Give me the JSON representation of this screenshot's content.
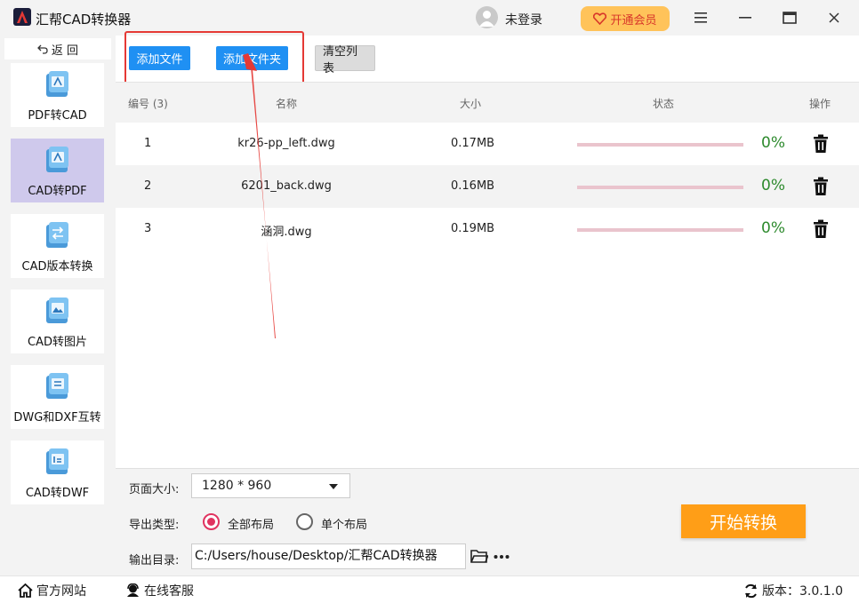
{
  "app": {
    "title": "汇帮CAD转换器",
    "user": "未登录",
    "vip": "开通会员"
  },
  "sidebar": {
    "back": "返 回",
    "items": [
      {
        "label": "PDF转CAD"
      },
      {
        "label": "CAD转PDF",
        "active": true
      },
      {
        "label": "CAD版本转换"
      },
      {
        "label": "CAD转图片"
      },
      {
        "label": "DWG和DXF互转"
      },
      {
        "label": "CAD转DWF"
      }
    ]
  },
  "toolbar": {
    "add_file": "添加文件",
    "add_folder": "添加文件夹",
    "clear_list": "清空列表"
  },
  "table": {
    "headers": {
      "index": "编号 (3)",
      "name": "名称",
      "size": "大小",
      "status": "状态",
      "action": "操作"
    },
    "rows": [
      {
        "index": "1",
        "name": "kr26-pp_left.dwg",
        "size": "0.17MB",
        "progress": "0%"
      },
      {
        "index": "2",
        "name": "6201_back.dwg",
        "size": "0.16MB",
        "progress": "0%"
      },
      {
        "index": "3",
        "name": "涵洞.dwg",
        "size": "0.19MB",
        "progress": "0%"
      }
    ]
  },
  "settings": {
    "page_size_label": "页面大小:",
    "page_size_value": "1280 * 960",
    "export_type_label": "导出类型:",
    "option_all": "全部布局",
    "option_single": "单个布局",
    "output_dir_label": "输出目录:",
    "output_dir_value": "C:/Users/house/Desktop/汇帮CAD转换器",
    "start": "开始转换"
  },
  "footer": {
    "website": "官方网站",
    "support": "在线客服",
    "version": "版本：3.0.1.0"
  },
  "colors": {
    "accent_blue": "#1f90f3",
    "start_orange": "#ff9e17",
    "progress_green": "#2d8a2d",
    "highlight_red": "#e53935",
    "active_purple": "#cfc9ec"
  }
}
